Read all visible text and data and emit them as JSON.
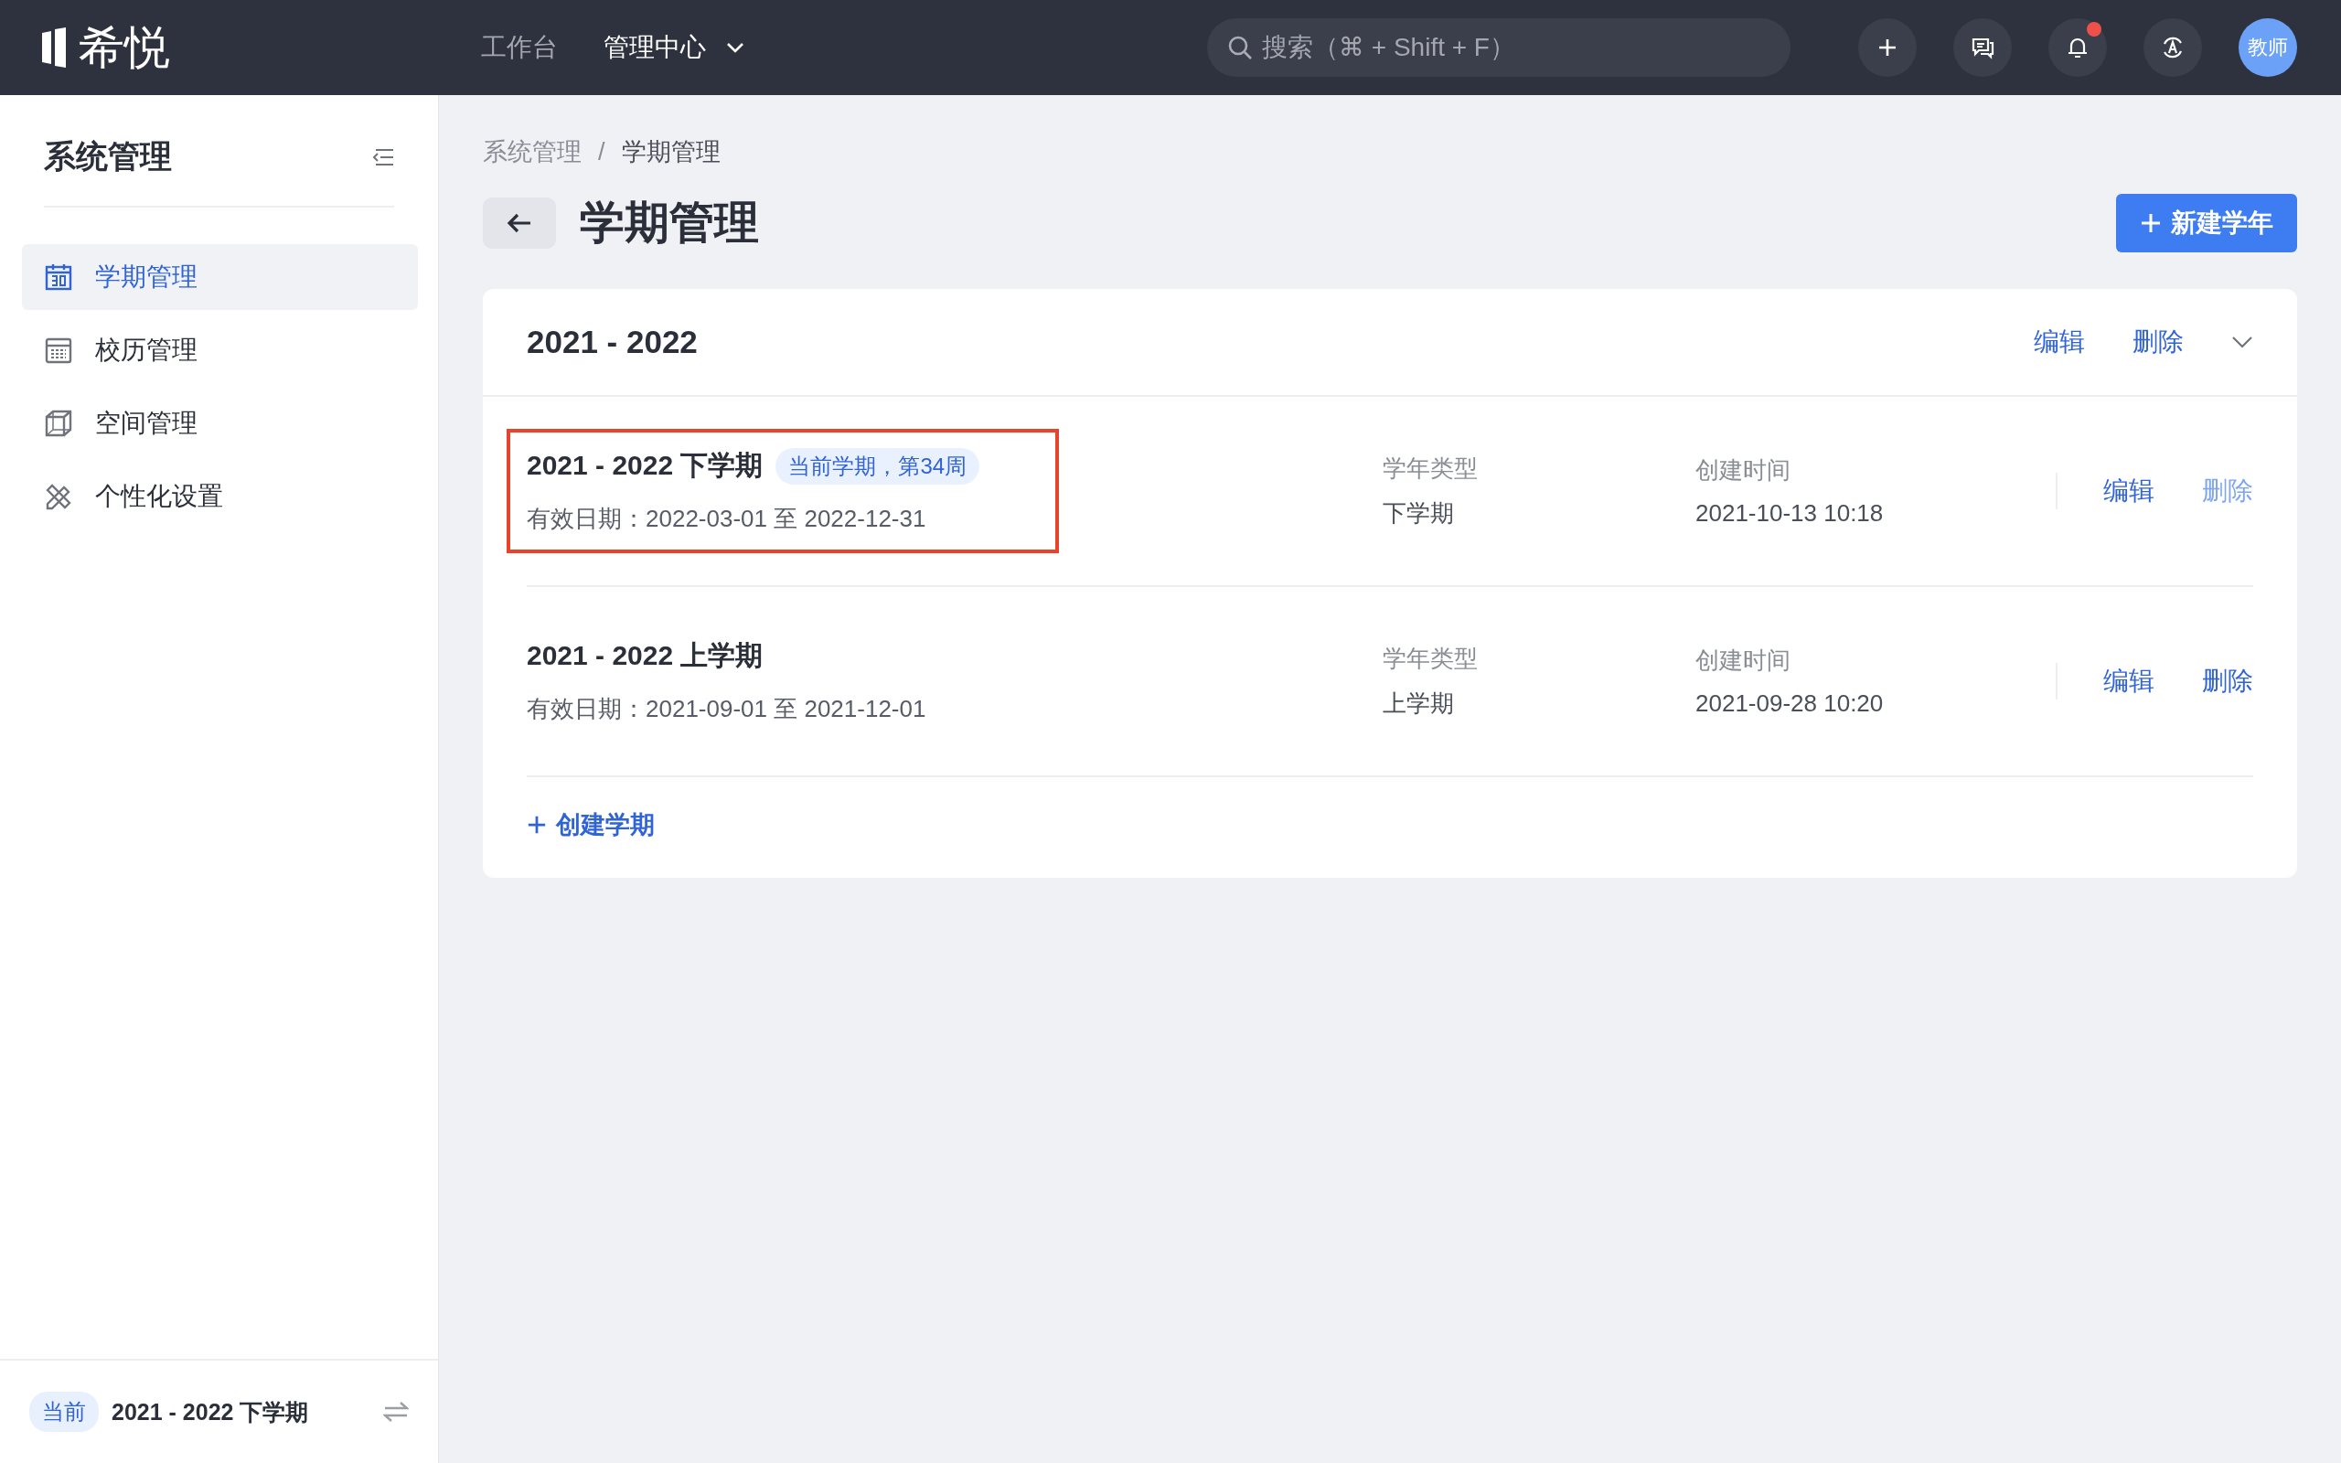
{
  "top_bar": {
    "logo_text": "希悦",
    "nav": [
      {
        "label": "工作台",
        "selected": false,
        "has_dropdown": false
      },
      {
        "label": "管理中心",
        "selected": true,
        "has_dropdown": true
      }
    ],
    "search": {
      "placeholder": "搜索（⌘ + Shift + F）"
    },
    "notification_dot": true,
    "avatar": "教师"
  },
  "sidebar": {
    "title": "系统管理",
    "items": [
      {
        "label": "学期管理",
        "kind": "term",
        "selected": true
      },
      {
        "label": "校历管理",
        "kind": "calendar",
        "selected": false
      },
      {
        "label": "空间管理",
        "kind": "space",
        "selected": false
      },
      {
        "label": "个性化设置",
        "kind": "custom",
        "selected": false
      }
    ],
    "footer": {
      "badge": "当前",
      "term": "2021 - 2022 下学期"
    }
  },
  "breadcrumb": {
    "items": [
      "系统管理",
      "学期管理"
    ],
    "separator": "/"
  },
  "page_title": "学期管理",
  "new_button": "新建学年",
  "year_card": {
    "title": "2021 - 2022",
    "actions": [
      "编辑",
      "删除"
    ],
    "expanded": true,
    "terms": [
      {
        "title": "2021 - 2022 下学期",
        "tag": "当前学期，第34周",
        "dates": "有效日期：2022-03-01 至 2022-12-31",
        "type_label": "学年类型",
        "type": "下学期",
        "time_label": "创建时间",
        "time": "2021-10-13 10:18",
        "actions": [
          {
            "label": "编辑",
            "disabled": false
          },
          {
            "label": "删除",
            "disabled": true
          }
        ],
        "highlighted": true
      },
      {
        "title": "2021 - 2022 上学期",
        "dates": "有效日期：2021-09-01 至 2021-12-01",
        "type_label": "学年类型",
        "type": "上学期",
        "time_label": "创建时间",
        "time": "2021-09-28 10:20",
        "actions": [
          {
            "label": "编辑",
            "disabled": false
          },
          {
            "label": "删除",
            "disabled": false
          }
        ],
        "highlighted": false
      }
    ],
    "create_link": "创建学期"
  }
}
